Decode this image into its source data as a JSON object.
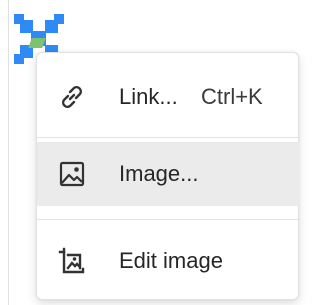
{
  "selection": {
    "image_icon": "image-placeholder-icon",
    "handle_color": "#2f8af5"
  },
  "menu": {
    "items": [
      {
        "label": "Link...",
        "shortcut": "Ctrl+K",
        "icon": "link-icon"
      },
      {
        "label": "Image...",
        "icon": "image-icon",
        "highlighted": true
      },
      {
        "label": "Edit image",
        "icon": "crop-icon"
      }
    ],
    "highlight_color": "#ebebeb"
  }
}
